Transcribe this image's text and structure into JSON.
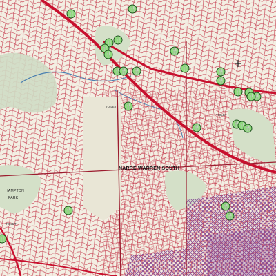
{
  "map": {
    "suburbs": [
      {
        "name": "NARRE WARREN SOUTH"
      },
      {
        "name": "HAMPTON"
      },
      {
        "name": "PARK"
      }
    ],
    "toilet_label": "TOILET",
    "poi_glyph": "🍴",
    "colors": {
      "background": "#f3efe3",
      "street": "#c0283e",
      "highway": "#c8102e",
      "park": "#cfdcc4",
      "poi_fill": "#8fdc7e",
      "poi_border": "#1b4f1b",
      "purple_zone": "#7a3b8f"
    },
    "poi_count": 32,
    "icons": [
      "restaurant-icon",
      "toilet-label"
    ]
  }
}
